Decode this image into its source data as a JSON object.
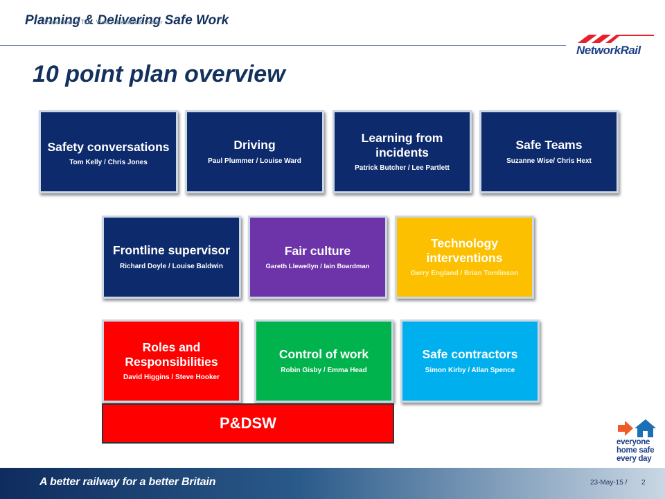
{
  "header": {
    "title": "Planning & Delivering Safe Work",
    "presentation_title": "Presentation Title: View > Header & Footer"
  },
  "logo": {
    "text": "NetworkRail",
    "colors": {
      "chevron": "#e7202b",
      "text": "#1d3f87"
    }
  },
  "slide": {
    "title": "10 point plan overview"
  },
  "tiles": [
    {
      "title": "Safety conversations",
      "names": "Tom Kelly / Chris Jones",
      "color": "#0d2a6c"
    },
    {
      "title": "Driving",
      "names": "Paul Plummer / Louise Ward",
      "color": "#0d2a6c"
    },
    {
      "title": "Learning from incidents",
      "names": "Patrick Butcher   / Lee Partlett",
      "color": "#0d2a6c"
    },
    {
      "title": "Safe Teams",
      "names": "Suzanne Wise/ Chris Hext",
      "color": "#0d2a6c"
    },
    {
      "title": "Frontline supervisor",
      "names": "Richard Doyle / Louise Baldwin",
      "color": "#0d2a6c"
    },
    {
      "title": "Fair culture",
      "names": "Gareth Llewellyn / Iain Boardman",
      "color": "#6c34a8"
    },
    {
      "title": "Technology interventions",
      "names": "Gerry England / Brian Tomlinson",
      "color": "#fcc000"
    },
    {
      "title": "Roles and Responsibilities",
      "names": "David Higgins   / Steve Hooker",
      "color": "#ff0000"
    },
    {
      "title": "Control of work",
      "names": "Robin Gisby / Emma Head",
      "color": "#00b34c"
    },
    {
      "title": "Safe contractors",
      "names": "Simon Kirby / Allan Spence",
      "color": "#00b0ee"
    }
  ],
  "bar": {
    "label": "P&DSW",
    "color": "#ff0000"
  },
  "campaign": {
    "lines": [
      "everyone",
      "home safe",
      "every day"
    ],
    "icon": "arrow-house-icon",
    "colors": {
      "arrow": "#f05a28",
      "house": "#1c6fb5",
      "text": "#1d3f87"
    }
  },
  "footer": {
    "tagline": "A better railway for a better Britain",
    "date": "23-May-15 /",
    "page": "2"
  }
}
